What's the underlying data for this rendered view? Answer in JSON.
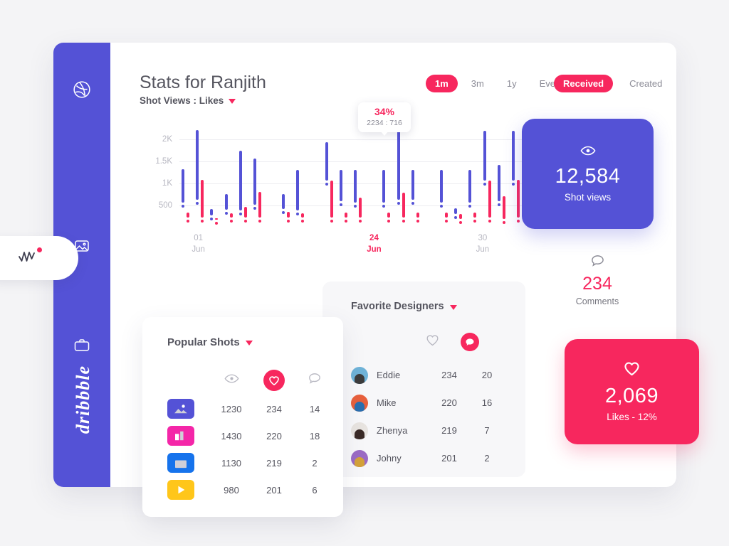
{
  "header": {
    "title": "Stats for Ranjith",
    "subtitle": "Shot Views : Likes",
    "range_filters": [
      {
        "label": "1m",
        "active": true
      },
      {
        "label": "3m",
        "active": false
      },
      {
        "label": "1y",
        "active": false
      },
      {
        "label": "Ever",
        "active": false
      }
    ],
    "type_filters": [
      {
        "label": "Received",
        "active": true
      },
      {
        "label": "Created",
        "active": false
      }
    ]
  },
  "sidebar": {
    "wordmark": "dribbble",
    "items": [
      {
        "icon": "dribbble-logo-icon",
        "name": "dribbble"
      },
      {
        "icon": "image-icon",
        "name": "shots"
      },
      {
        "icon": "activity-icon",
        "name": "stats",
        "active": true,
        "badge": true
      },
      {
        "icon": "briefcase-icon",
        "name": "jobs"
      }
    ]
  },
  "tooltip": {
    "percent": "34%",
    "values": "2234 : 716"
  },
  "chart_data": {
    "type": "bar",
    "title": "Shot Views : Likes",
    "xlabel": "",
    "ylabel": "",
    "ylim": [
      0,
      2250
    ],
    "grid": true,
    "ytick_labels": [
      "2K",
      "1.5K",
      "1K",
      "500"
    ],
    "ytick_values": [
      2000,
      1500,
      1000,
      500
    ],
    "xtick_labels": [
      {
        "day": "01",
        "month": "Jun",
        "highlight": false
      },
      {
        "day": "24",
        "month": "Jun",
        "highlight": true
      },
      {
        "day": "30",
        "month": "Jun",
        "highlight": false
      }
    ],
    "legend": [
      "Shot views",
      "Likes"
    ],
    "series": [
      {
        "name": "Shot views",
        "color": "#5452d6",
        "low": [
          560,
          620,
          280,
          400,
          380,
          520,
          0,
          420,
          380,
          0,
          1060,
          590,
          560,
          0,
          560,
          620,
          620,
          0,
          560,
          310,
          560,
          1060,
          600,
          1060
        ],
        "high": [
          1320,
          2200,
          420,
          760,
          1730,
          1560,
          0,
          760,
          1300,
          0,
          1930,
          1310,
          1310,
          0,
          1310,
          2180,
          1310,
          0,
          1310,
          430,
          1310,
          2190,
          1420,
          2190
        ]
      },
      {
        "name": "Likes",
        "color": "#f7275e",
        "low": [
          230,
          230,
          170,
          230,
          230,
          230,
          0,
          230,
          230,
          0,
          230,
          230,
          230,
          0,
          230,
          230,
          230,
          0,
          230,
          200,
          230,
          230,
          200,
          230
        ],
        "high": [
          330,
          1070,
          200,
          320,
          460,
          800,
          0,
          350,
          320,
          0,
          1060,
          330,
          680,
          0,
          330,
          790,
          330,
          0,
          330,
          300,
          330,
          1060,
          700,
          1070
        ]
      }
    ]
  },
  "stats": {
    "views": {
      "value": "12,584",
      "label": "Shot views",
      "icon": "eye-icon",
      "color": "#5452d6"
    },
    "comments": {
      "value": "234",
      "label": "Comments",
      "icon": "comment-icon",
      "color": "#f7275e"
    },
    "likes": {
      "value": "2,069",
      "label": "Likes - 12%",
      "icon": "heart-icon",
      "color": "#f7275e"
    }
  },
  "favorite_designers": {
    "title": "Favorite Designers",
    "columns": [
      {
        "icon": "heart-outline-icon",
        "active": false
      },
      {
        "icon": "comment-icon",
        "active": true
      }
    ],
    "rows": [
      {
        "name": "Eddie",
        "likes": "234",
        "comments": "20",
        "avatar_colors": [
          "#6fb3d8",
          "#3c3c3c"
        ]
      },
      {
        "name": "Mike",
        "likes": "220",
        "comments": "16",
        "avatar_colors": [
          "#e8603c",
          "#2a6fb0"
        ]
      },
      {
        "name": "Zhenya",
        "likes": "219",
        "comments": "7",
        "avatar_colors": [
          "#e8e4e0",
          "#3a2a26"
        ]
      },
      {
        "name": "Johny",
        "likes": "201",
        "comments": "2",
        "avatar_colors": [
          "#9b6bc4",
          "#d4a23a"
        ]
      }
    ]
  },
  "popular_shots": {
    "title": "Popular Shots",
    "columns": [
      {
        "icon": "eye-icon",
        "active": false
      },
      {
        "icon": "heart-icon",
        "active": true
      },
      {
        "icon": "comment-icon",
        "active": false
      }
    ],
    "rows": [
      {
        "thumb": "image-shot",
        "thumb_color": "#5452d6",
        "views": "1230",
        "likes": "234",
        "comments": "14"
      },
      {
        "thumb": "chart-shot",
        "thumb_color": "#f426a8",
        "views": "1430",
        "likes": "220",
        "comments": "18"
      },
      {
        "thumb": "window-shot",
        "thumb_color": "#1673ec",
        "views": "1130",
        "likes": "219",
        "comments": "2"
      },
      {
        "thumb": "video-shot",
        "thumb_color": "#ffc61a",
        "views": "980",
        "likes": "201",
        "comments": "6"
      }
    ]
  }
}
